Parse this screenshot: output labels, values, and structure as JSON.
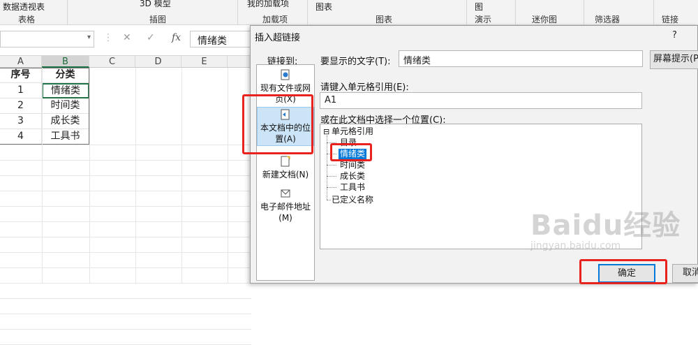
{
  "ribbon": {
    "items": [
      "数据透视表",
      "3D 模型",
      "我的加载项",
      "图表",
      "图",
      "筛选器",
      "链接"
    ],
    "groups": [
      "表格",
      "插图",
      "加载项",
      "图表",
      "演示",
      "迷你图",
      "筛选器",
      "链接"
    ]
  },
  "formula_bar": {
    "cancel": "✕",
    "enter": "✓",
    "fx": "fx",
    "value": "情绪类"
  },
  "sheet": {
    "columns": [
      "A",
      "B",
      "C",
      "D",
      "E"
    ],
    "header_row": [
      "序号",
      "分类"
    ],
    "rows": [
      [
        "1",
        "情绪类"
      ],
      [
        "2",
        "时间类"
      ],
      [
        "3",
        "成长类"
      ],
      [
        "4",
        "工具书"
      ]
    ]
  },
  "dialog": {
    "title": "插入超链接",
    "help": "?",
    "close": "✕",
    "link_to_label": "链接到:",
    "link_items": [
      {
        "label_line1": "现有文件或网",
        "label_line2": "页(X)"
      },
      {
        "label_line1": "本文档中的位",
        "label_line2": "置(A)"
      },
      {
        "label_line1": "新建文档(N)",
        "label_line2": ""
      },
      {
        "label_line1": "电子邮件地址",
        "label_line2": "(M)"
      }
    ],
    "display_text_label": "要显示的文字(T):",
    "display_text_value": "情绪类",
    "screen_tip_button": "屏幕提示(P)",
    "cell_ref_label": "请键入单元格引用(E):",
    "cell_ref_value": "A1",
    "place_label": "或在此文档中选择一个位置(C):",
    "tree": {
      "root": "单元格引用",
      "children": [
        "目录",
        "情绪类",
        "时间类",
        "成长类",
        "工具书"
      ],
      "root2": "已定义名称"
    },
    "ok_button": "确定",
    "cancel_button": "取消"
  },
  "watermark": {
    "brand": "Baidu经验",
    "url": "jingyan.baidu.com"
  },
  "colors": {
    "excel_green": "#217346",
    "highlight_red": "#e8231f",
    "selection_blue": "#0078d7"
  }
}
